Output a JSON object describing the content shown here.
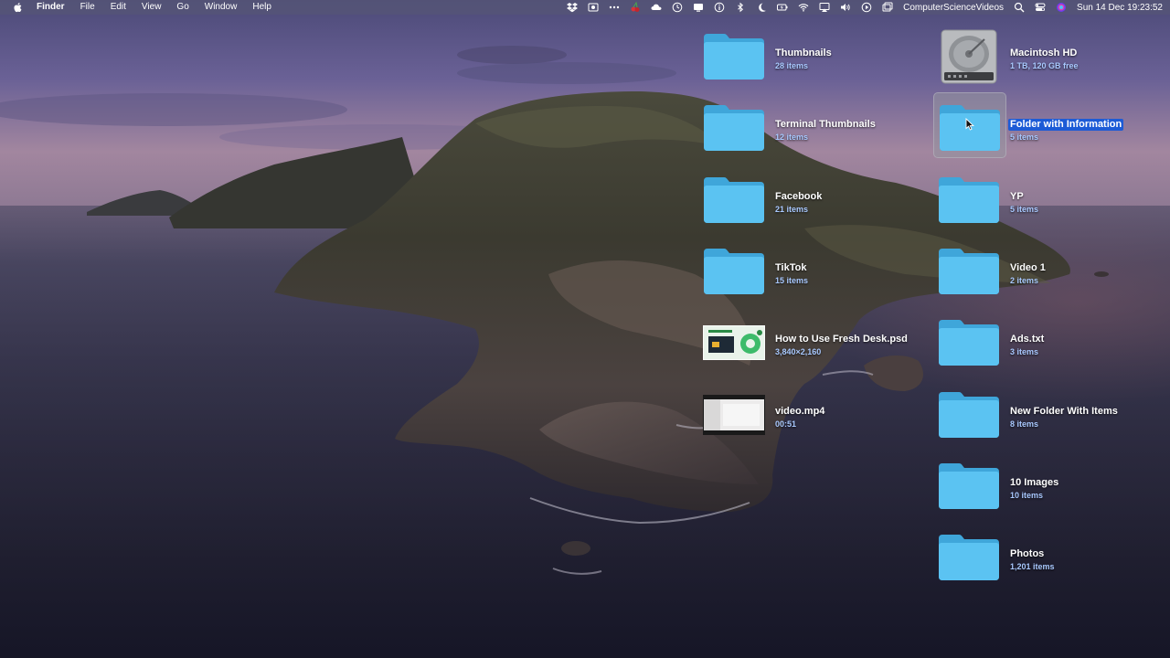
{
  "menubar": {
    "app_name": "Finder",
    "menus": [
      "File",
      "Edit",
      "View",
      "Go",
      "Window",
      "Help"
    ],
    "status_icons": [
      "dropbox-icon",
      "screen-record-icon",
      "more-icon",
      "cherry-icon",
      "cloud-icon",
      "clock-icon",
      "display-icon",
      "info-icon",
      "bluetooth-icon",
      "moon-icon",
      "battery-icon",
      "wifi-icon",
      "airplay-icon",
      "volume-icon",
      "play-icon",
      "window-icon"
    ],
    "user_name": "ComputerScienceVideos",
    "clock": "Sun 14 Dec  19:23:52"
  },
  "desktop": {
    "column_left": [
      {
        "name": "Thumbnails",
        "info": "28 items",
        "type": "folder"
      },
      {
        "name": "Terminal Thumbnails",
        "info": "12 items",
        "type": "folder"
      },
      {
        "name": "Facebook",
        "info": "21 items",
        "type": "folder"
      },
      {
        "name": "TikTok",
        "info": "15 items",
        "type": "folder"
      },
      {
        "name": "How to Use Fresh Desk.psd",
        "info": "3,840×2,160",
        "type": "psd"
      },
      {
        "name": "video.mp4",
        "info": "00:51",
        "type": "video"
      }
    ],
    "column_right": [
      {
        "name": "Macintosh HD",
        "info": "1 TB, 120 GB free",
        "type": "disk"
      },
      {
        "name": "Folder with Information",
        "info": "5 items",
        "type": "folder",
        "selected": true
      },
      {
        "name": "YP",
        "info": "5 items",
        "type": "folder"
      },
      {
        "name": "Video 1",
        "info": "2 items",
        "type": "folder"
      },
      {
        "name": "Ads.txt",
        "info": "3 items",
        "type": "folder"
      },
      {
        "name": "New Folder With Items",
        "info": "8 items",
        "type": "folder"
      },
      {
        "name": "10 Images",
        "info": "10 items",
        "type": "folder"
      },
      {
        "name": "Photos",
        "info": "1,201 items",
        "type": "folder"
      }
    ]
  },
  "colors": {
    "folder_front": "#5bc3f2",
    "folder_back": "#3fa6da",
    "selection_blue": "#1c5bd6",
    "info_text": "#a9c9ff"
  }
}
